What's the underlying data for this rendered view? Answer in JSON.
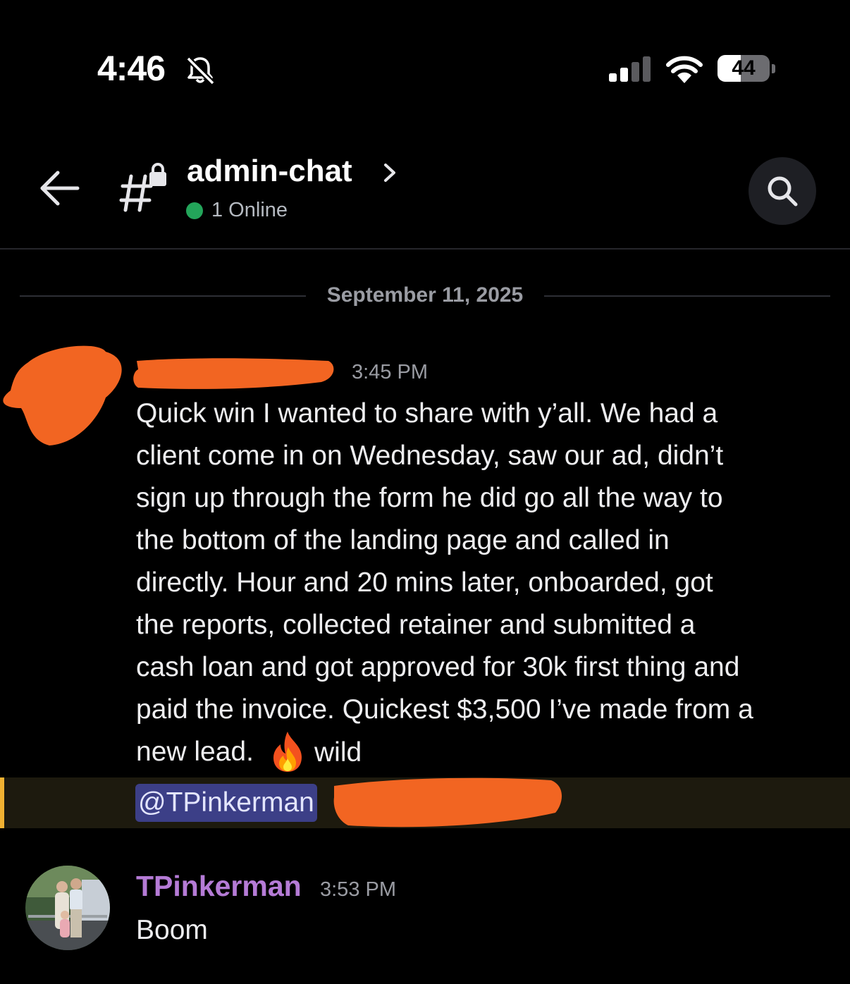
{
  "status_bar": {
    "time": "4:46",
    "battery_level": "44",
    "battery_fraction": 0.44,
    "icons": [
      "bell-slash-icon",
      "cellular-signal-icon",
      "wifi-icon",
      "battery-icon"
    ]
  },
  "header": {
    "channel_name": "admin-chat",
    "online_status": "1 Online",
    "icons": [
      "back-arrow-icon",
      "locked-channel-hash-icon",
      "chevron-right-icon",
      "search-icon"
    ]
  },
  "date_divider": "September 11, 2025",
  "messages": [
    {
      "time": "3:45 PM",
      "lines": [
        "Quick win I wanted to share with y’all. We had a",
        "client come in on Wednesday, saw our ad, didn’t",
        "sign up through the form he did go all the way to",
        "the bottom of the landing page and called in",
        "directly. Hour and 20 mins later, onboarded, got",
        "the reports, collected retainer and submitted a",
        "cash loan and got approved for 30k first thing and",
        "paid the invoice. Quickest $3,500 I’ve made from a",
        "new lead."
      ],
      "emoji": "fire-emoji",
      "tail": "wild",
      "mention": "@TPinkerman"
    },
    {
      "author": "TPinkerman",
      "time": "3:53 PM",
      "text": "Boom"
    }
  ],
  "colors": {
    "background": "#000000",
    "online": "#23a55a",
    "mention_bar": "#f0b132",
    "mention_chip": "#3c3f87",
    "author_name": "#b57bd6",
    "redaction": "#f26522"
  }
}
